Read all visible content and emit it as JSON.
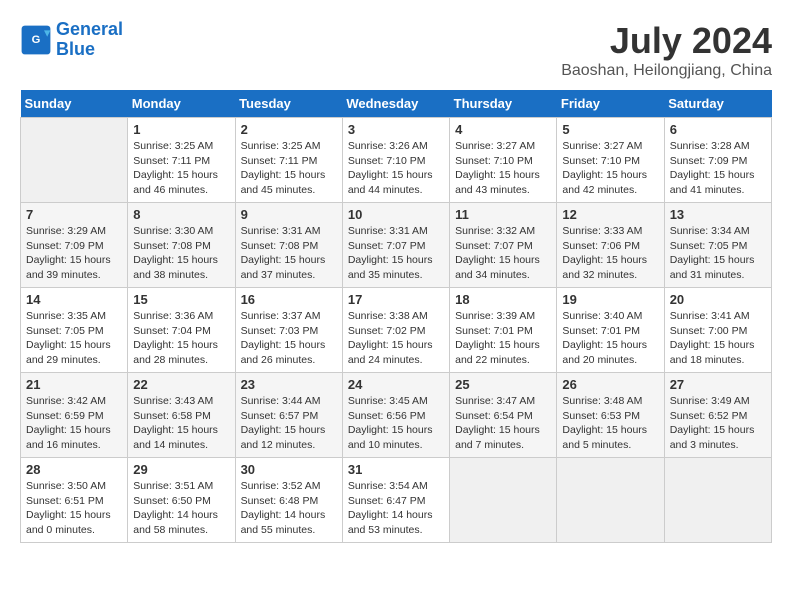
{
  "header": {
    "logo_line1": "General",
    "logo_line2": "Blue",
    "title": "July 2024",
    "subtitle": "Baoshan, Heilongjiang, China"
  },
  "days_of_week": [
    "Sunday",
    "Monday",
    "Tuesday",
    "Wednesday",
    "Thursday",
    "Friday",
    "Saturday"
  ],
  "weeks": [
    [
      {
        "day": "",
        "info": ""
      },
      {
        "day": "1",
        "info": "Sunrise: 3:25 AM\nSunset: 7:11 PM\nDaylight: 15 hours\nand 46 minutes."
      },
      {
        "day": "2",
        "info": "Sunrise: 3:25 AM\nSunset: 7:11 PM\nDaylight: 15 hours\nand 45 minutes."
      },
      {
        "day": "3",
        "info": "Sunrise: 3:26 AM\nSunset: 7:10 PM\nDaylight: 15 hours\nand 44 minutes."
      },
      {
        "day": "4",
        "info": "Sunrise: 3:27 AM\nSunset: 7:10 PM\nDaylight: 15 hours\nand 43 minutes."
      },
      {
        "day": "5",
        "info": "Sunrise: 3:27 AM\nSunset: 7:10 PM\nDaylight: 15 hours\nand 42 minutes."
      },
      {
        "day": "6",
        "info": "Sunrise: 3:28 AM\nSunset: 7:09 PM\nDaylight: 15 hours\nand 41 minutes."
      }
    ],
    [
      {
        "day": "7",
        "info": "Sunrise: 3:29 AM\nSunset: 7:09 PM\nDaylight: 15 hours\nand 39 minutes."
      },
      {
        "day": "8",
        "info": "Sunrise: 3:30 AM\nSunset: 7:08 PM\nDaylight: 15 hours\nand 38 minutes."
      },
      {
        "day": "9",
        "info": "Sunrise: 3:31 AM\nSunset: 7:08 PM\nDaylight: 15 hours\nand 37 minutes."
      },
      {
        "day": "10",
        "info": "Sunrise: 3:31 AM\nSunset: 7:07 PM\nDaylight: 15 hours\nand 35 minutes."
      },
      {
        "day": "11",
        "info": "Sunrise: 3:32 AM\nSunset: 7:07 PM\nDaylight: 15 hours\nand 34 minutes."
      },
      {
        "day": "12",
        "info": "Sunrise: 3:33 AM\nSunset: 7:06 PM\nDaylight: 15 hours\nand 32 minutes."
      },
      {
        "day": "13",
        "info": "Sunrise: 3:34 AM\nSunset: 7:05 PM\nDaylight: 15 hours\nand 31 minutes."
      }
    ],
    [
      {
        "day": "14",
        "info": "Sunrise: 3:35 AM\nSunset: 7:05 PM\nDaylight: 15 hours\nand 29 minutes."
      },
      {
        "day": "15",
        "info": "Sunrise: 3:36 AM\nSunset: 7:04 PM\nDaylight: 15 hours\nand 28 minutes."
      },
      {
        "day": "16",
        "info": "Sunrise: 3:37 AM\nSunset: 7:03 PM\nDaylight: 15 hours\nand 26 minutes."
      },
      {
        "day": "17",
        "info": "Sunrise: 3:38 AM\nSunset: 7:02 PM\nDaylight: 15 hours\nand 24 minutes."
      },
      {
        "day": "18",
        "info": "Sunrise: 3:39 AM\nSunset: 7:01 PM\nDaylight: 15 hours\nand 22 minutes."
      },
      {
        "day": "19",
        "info": "Sunrise: 3:40 AM\nSunset: 7:01 PM\nDaylight: 15 hours\nand 20 minutes."
      },
      {
        "day": "20",
        "info": "Sunrise: 3:41 AM\nSunset: 7:00 PM\nDaylight: 15 hours\nand 18 minutes."
      }
    ],
    [
      {
        "day": "21",
        "info": "Sunrise: 3:42 AM\nSunset: 6:59 PM\nDaylight: 15 hours\nand 16 minutes."
      },
      {
        "day": "22",
        "info": "Sunrise: 3:43 AM\nSunset: 6:58 PM\nDaylight: 15 hours\nand 14 minutes."
      },
      {
        "day": "23",
        "info": "Sunrise: 3:44 AM\nSunset: 6:57 PM\nDaylight: 15 hours\nand 12 minutes."
      },
      {
        "day": "24",
        "info": "Sunrise: 3:45 AM\nSunset: 6:56 PM\nDaylight: 15 hours\nand 10 minutes."
      },
      {
        "day": "25",
        "info": "Sunrise: 3:47 AM\nSunset: 6:54 PM\nDaylight: 15 hours\nand 7 minutes."
      },
      {
        "day": "26",
        "info": "Sunrise: 3:48 AM\nSunset: 6:53 PM\nDaylight: 15 hours\nand 5 minutes."
      },
      {
        "day": "27",
        "info": "Sunrise: 3:49 AM\nSunset: 6:52 PM\nDaylight: 15 hours\nand 3 minutes."
      }
    ],
    [
      {
        "day": "28",
        "info": "Sunrise: 3:50 AM\nSunset: 6:51 PM\nDaylight: 15 hours\nand 0 minutes."
      },
      {
        "day": "29",
        "info": "Sunrise: 3:51 AM\nSunset: 6:50 PM\nDaylight: 14 hours\nand 58 minutes."
      },
      {
        "day": "30",
        "info": "Sunrise: 3:52 AM\nSunset: 6:48 PM\nDaylight: 14 hours\nand 55 minutes."
      },
      {
        "day": "31",
        "info": "Sunrise: 3:54 AM\nSunset: 6:47 PM\nDaylight: 14 hours\nand 53 minutes."
      },
      {
        "day": "",
        "info": ""
      },
      {
        "day": "",
        "info": ""
      },
      {
        "day": "",
        "info": ""
      }
    ]
  ]
}
